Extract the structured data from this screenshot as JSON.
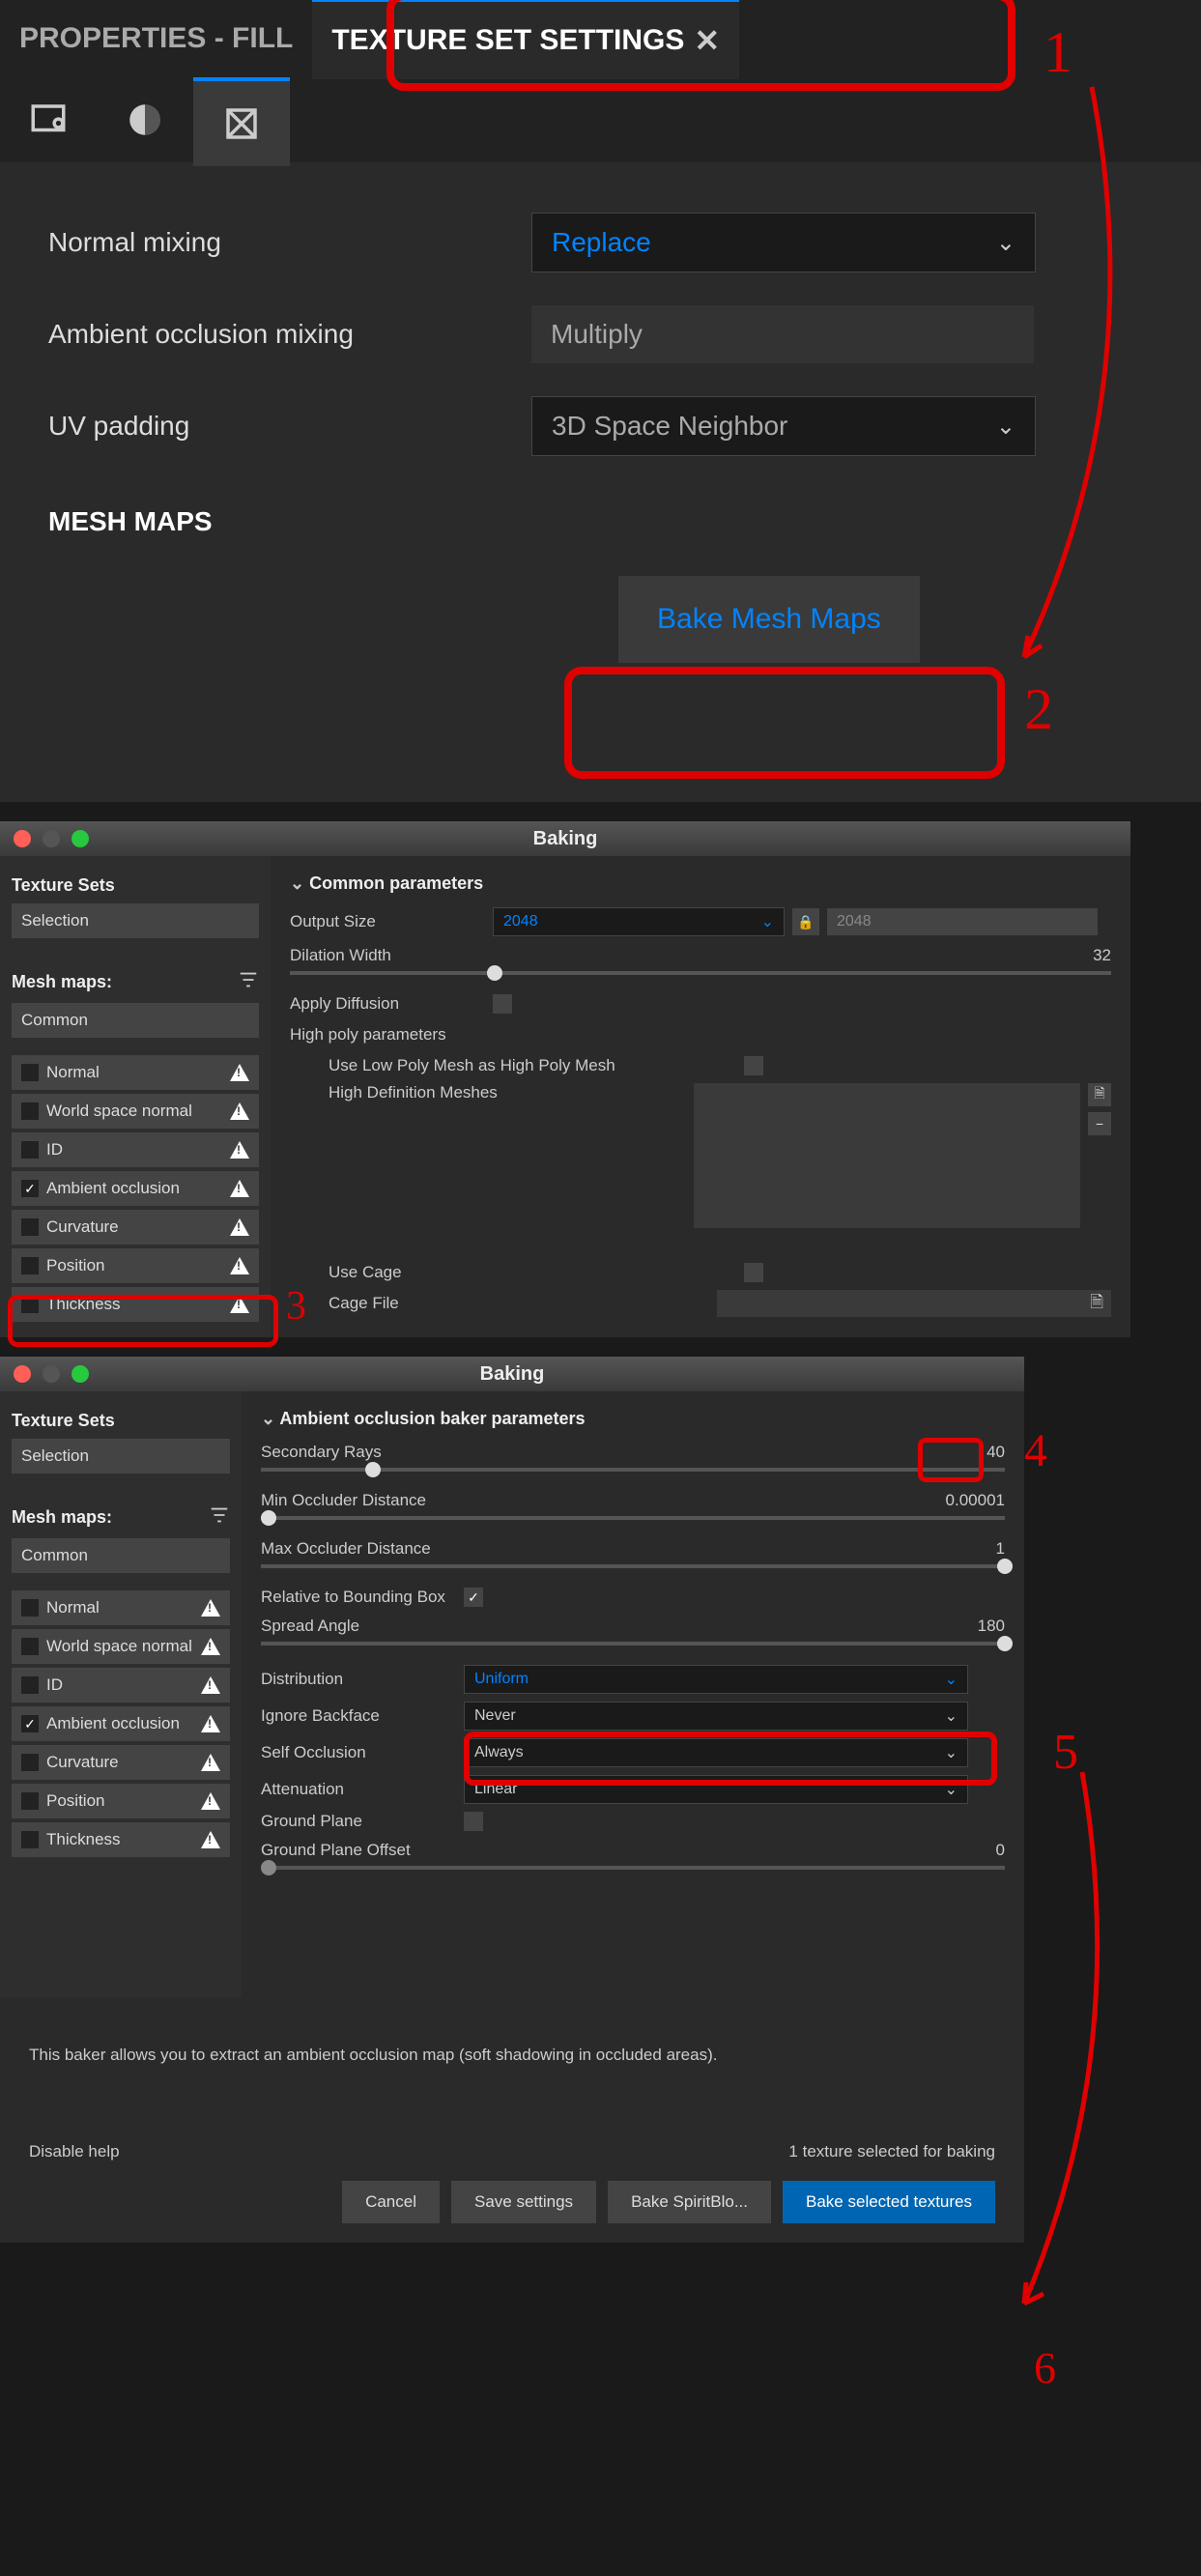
{
  "panel1": {
    "tab_inactive": "PROPERTIES - FILL",
    "tab_active": "TEXTURE SET SETTINGS",
    "rows": {
      "normal_mixing_label": "Normal mixing",
      "normal_mixing_value": "Replace",
      "ao_mixing_label": "Ambient occlusion mixing",
      "ao_mixing_value": "Multiply",
      "uv_padding_label": "UV padding",
      "uv_padding_value": "3D Space Neighbor"
    },
    "section": "MESH MAPS",
    "bake_btn": "Bake Mesh Maps"
  },
  "annotations": [
    "1",
    "2",
    "3",
    "4",
    "5",
    "6"
  ],
  "window2": {
    "title": "Baking",
    "sidebar": {
      "texture_sets_h": "Texture Sets",
      "selection": "Selection",
      "mesh_maps_h": "Mesh maps:",
      "common": "Common",
      "items": [
        {
          "label": "Normal",
          "checked": false
        },
        {
          "label": "World space normal",
          "checked": false
        },
        {
          "label": "ID",
          "checked": false
        },
        {
          "label": "Ambient occlusion",
          "checked": true
        },
        {
          "label": "Curvature",
          "checked": false
        },
        {
          "label": "Position",
          "checked": false
        },
        {
          "label": "Thickness",
          "checked": false
        }
      ]
    },
    "main": {
      "group": "Common parameters",
      "output_size_label": "Output Size",
      "output_size_value": "2048",
      "output_size_locked": "2048",
      "dilation_label": "Dilation Width",
      "dilation_value": "32",
      "apply_diffusion_label": "Apply Diffusion",
      "highpoly_h": "High poly parameters",
      "use_lowpoly_label": "Use Low Poly Mesh as High Poly Mesh",
      "highdef_label": "High Definition Meshes",
      "use_cage_label": "Use Cage",
      "cage_file_label": "Cage File"
    }
  },
  "window3": {
    "title": "Baking",
    "sidebar": {
      "texture_sets_h": "Texture Sets",
      "selection": "Selection",
      "mesh_maps_h": "Mesh maps:",
      "common": "Common",
      "items": [
        {
          "label": "Normal",
          "checked": false
        },
        {
          "label": "World space normal",
          "checked": false
        },
        {
          "label": "ID",
          "checked": false
        },
        {
          "label": "Ambient occlusion",
          "checked": true
        },
        {
          "label": "Curvature",
          "checked": false
        },
        {
          "label": "Position",
          "checked": false
        },
        {
          "label": "Thickness",
          "checked": false
        }
      ]
    },
    "main": {
      "group": "Ambient occlusion baker parameters",
      "secondary_rays_label": "Secondary Rays",
      "secondary_rays_value": "40",
      "min_occ_label": "Min Occluder Distance",
      "min_occ_value": "0.00001",
      "max_occ_label": "Max Occluder Distance",
      "max_occ_value": "1",
      "rel_bbox_label": "Relative to Bounding Box",
      "spread_label": "Spread Angle",
      "spread_value": "180",
      "distribution_label": "Distribution",
      "distribution_value": "Uniform",
      "ignore_backface_label": "Ignore Backface",
      "ignore_backface_value": "Never",
      "self_occ_label": "Self Occlusion",
      "self_occ_value": "Always",
      "attenuation_label": "Attenuation",
      "attenuation_value": "Linear",
      "ground_plane_label": "Ground Plane",
      "ground_offset_label": "Ground Plane Offset",
      "ground_offset_value": "0"
    },
    "footer": {
      "help": "This baker allows you to extract an ambient occlusion map (soft shadowing in occluded areas).",
      "disable_help": "Disable help",
      "status": "1 texture selected for baking",
      "btn_cancel": "Cancel",
      "btn_save": "Save settings",
      "btn_bake_obj": "Bake SpiritBlo...",
      "btn_bake_sel": "Bake selected textures"
    }
  }
}
